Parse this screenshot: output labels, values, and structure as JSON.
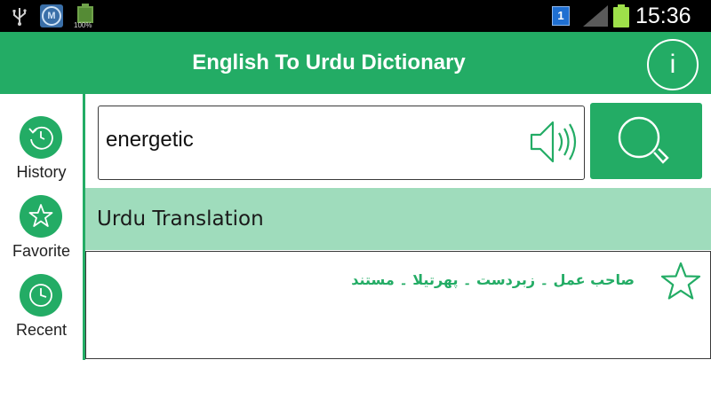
{
  "status_bar": {
    "time": "15:36",
    "notification_count": "1",
    "battery_percent": "100%",
    "app_icon_letter": "M",
    "icons": [
      "usb-icon",
      "app-notification-icon",
      "battery-small-icon",
      "notification-badge-icon",
      "signal-icon",
      "battery-icon"
    ]
  },
  "header": {
    "title": "English To Urdu Dictionary",
    "info_label": "i"
  },
  "sidebar": {
    "items": [
      {
        "label": "History",
        "icon": "history-icon"
      },
      {
        "label": "Favorite",
        "icon": "star-icon"
      },
      {
        "label": "Recent",
        "icon": "clock-icon"
      }
    ]
  },
  "search": {
    "value": "energetic",
    "speaker_icon": "speaker-icon",
    "button_icon": "search-icon"
  },
  "translation": {
    "header": "Urdu Translation",
    "text": "صاحب عمل ۔ زبردست ۔ پھرتیلا ۔ مستند",
    "favorite_icon": "star-outline-icon"
  },
  "colors": {
    "accent": "#23ac65",
    "section_bg": "#9fdcbc",
    "status_bar": "#000000"
  }
}
